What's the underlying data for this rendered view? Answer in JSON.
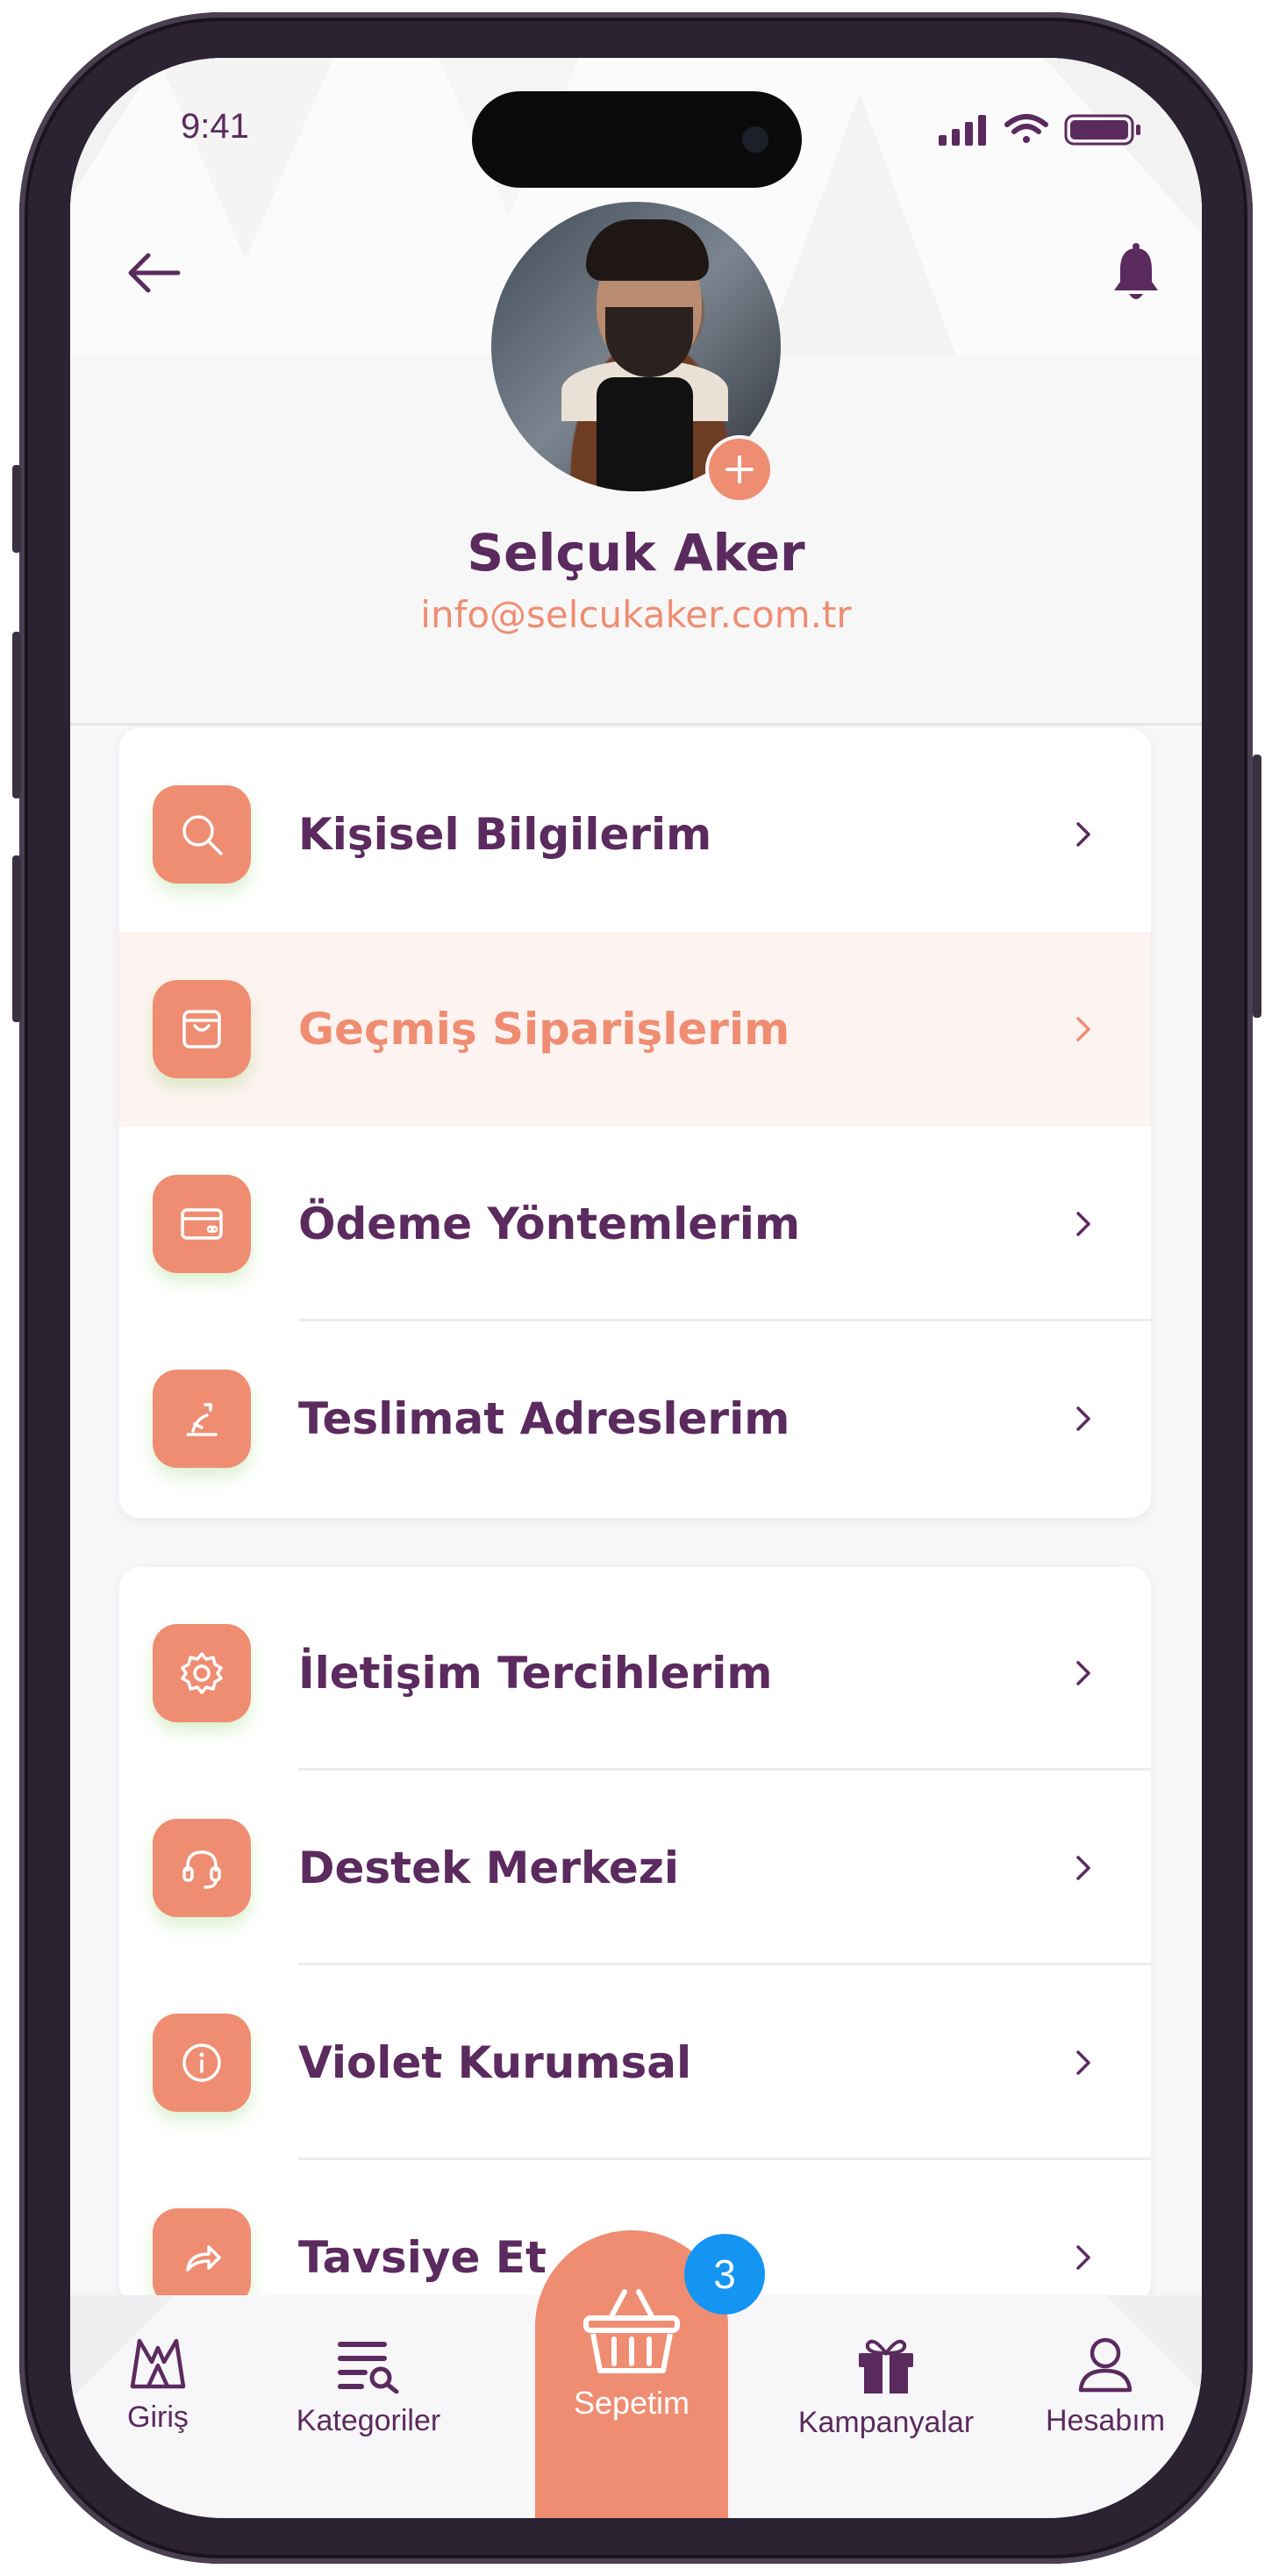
{
  "status_bar": {
    "time": "9:41"
  },
  "profile": {
    "name": "Selçuk Aker",
    "email": "info@selcukaker.com.tr"
  },
  "menu_group_1": [
    {
      "label": "Kişisel Bilgilerim",
      "icon": "search-icon"
    },
    {
      "label": "Geçmiş Siparişlerim",
      "icon": "shopping-bag-icon",
      "active": true
    },
    {
      "label": "Ödeme Yöntemlerim",
      "icon": "credit-card-icon"
    },
    {
      "label": "Teslimat Adreslerim",
      "icon": "delivery-location-icon"
    }
  ],
  "menu_group_2": [
    {
      "label": "İletişim Tercihlerim",
      "icon": "gear-icon"
    },
    {
      "label": "Destek Merkezi",
      "icon": "headset-icon"
    },
    {
      "label": "Violet Kurumsal",
      "icon": "info-icon"
    },
    {
      "label": "Tavsiye Et",
      "icon": "share-icon"
    }
  ],
  "tab_bar": {
    "tabs": [
      {
        "label": "Giriş",
        "icon": "home-icon"
      },
      {
        "label": "Kategoriler",
        "icon": "category-search-icon"
      },
      {
        "label": "Sepetim",
        "icon": "basket-icon",
        "active": true
      },
      {
        "label": "Kampanyalar",
        "icon": "gift-icon"
      },
      {
        "label": "Hesabım",
        "icon": "user-icon"
      }
    ],
    "cart_badge": "3"
  },
  "colors": {
    "primary": "#5b2a5e",
    "accent": "#ef8d72",
    "badge": "#1595f2"
  }
}
